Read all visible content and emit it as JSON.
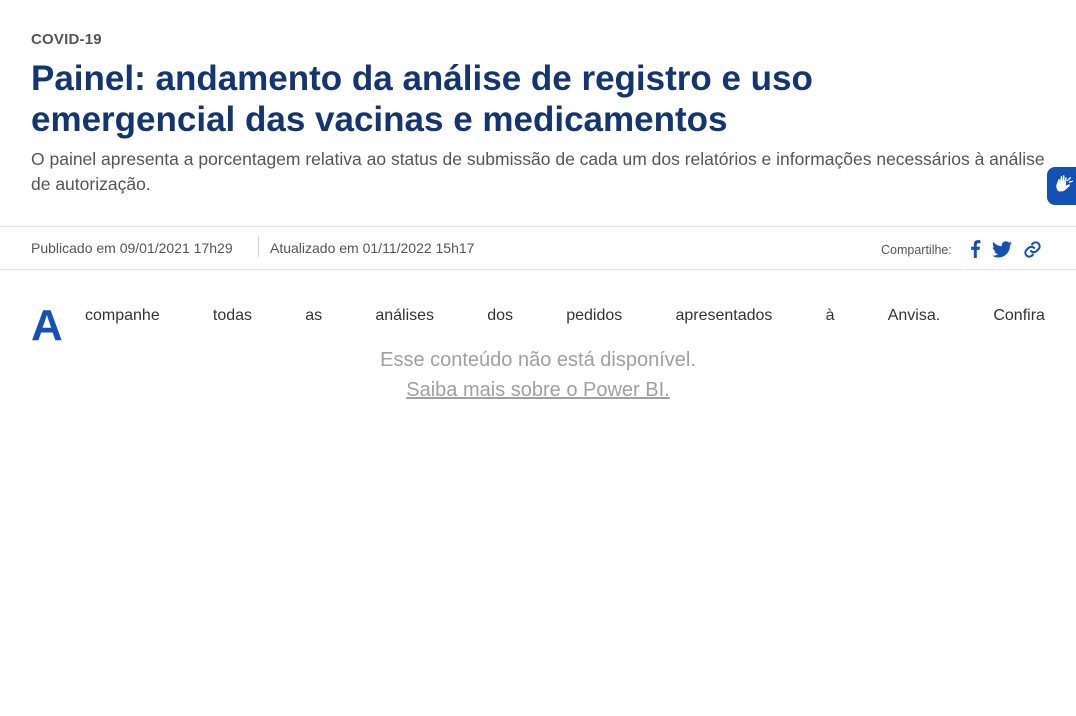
{
  "article": {
    "category": "COVID-19",
    "title": "Painel: andamento da análise de registro e uso emergencial das vacinas e medicamentos",
    "subtitle": "O painel apresenta a porcentagem relativa ao status de submissão de cada um dos relatórios e informações necessários à análise de autorização."
  },
  "meta": {
    "published": "Publicado em 09/01/2021 17h29",
    "updated": "Atualizado em 01/11/2022 15h17",
    "share_label": "Compartilhe:"
  },
  "body": {
    "dropcap": "A",
    "first_line_words": [
      "companhe",
      "todas",
      "as",
      "análises",
      "dos",
      "pedidos",
      "apresentados",
      "à",
      "Anvisa.",
      "Confira"
    ]
  },
  "embed": {
    "message": "Esse conteúdo não está disponível.",
    "link_text": "Saiba mais sobre o Power BI."
  },
  "icons": {
    "accessibility": "vlibras-hands-icon",
    "facebook": "facebook-icon",
    "twitter": "twitter-icon",
    "link": "link-icon"
  },
  "colors": {
    "title": "#133571",
    "accent": "#1351b4",
    "muted": "#a0a0a0"
  }
}
